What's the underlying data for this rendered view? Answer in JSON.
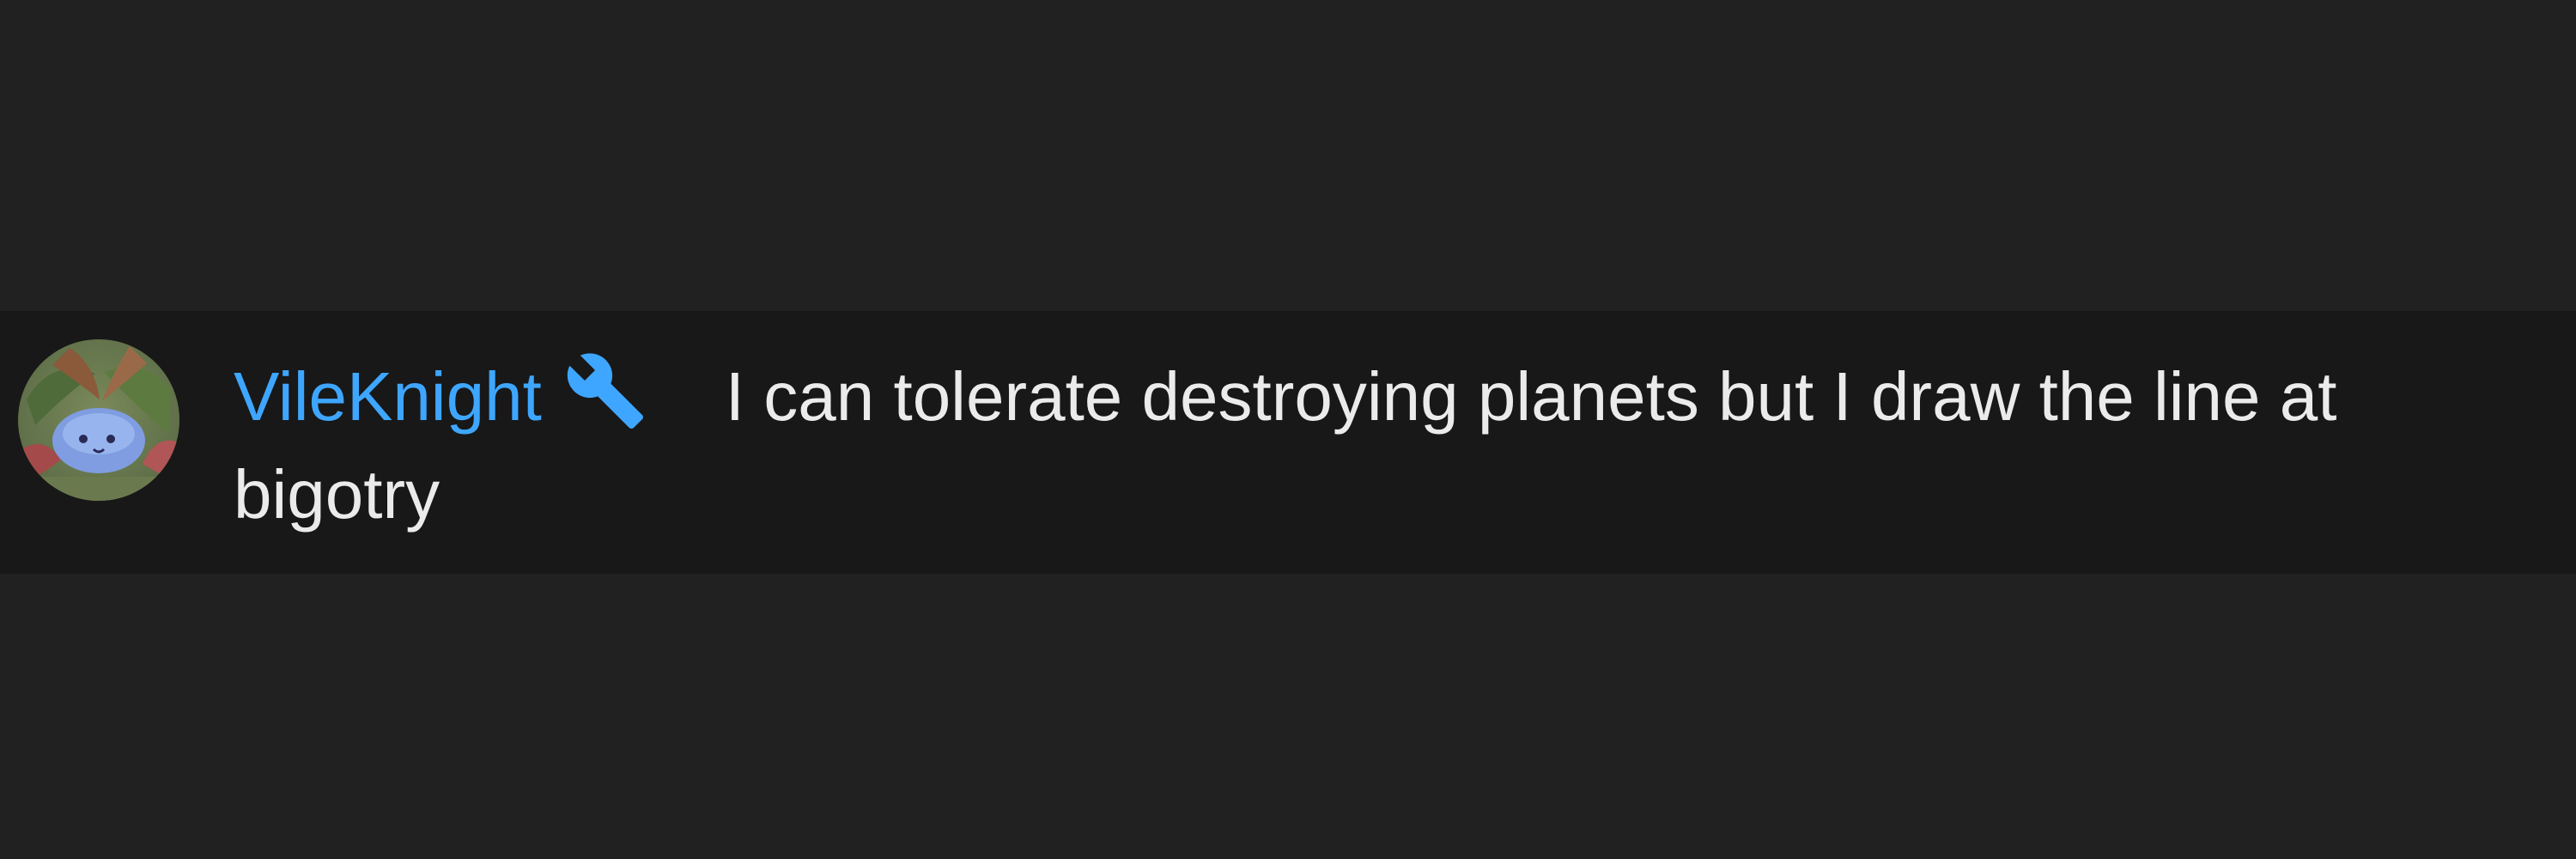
{
  "chat_message": {
    "author_name": "VileKnight",
    "badge_icon": "wrench-icon",
    "badge_color": "#3ea6ff",
    "author_color": "#3ea6ff",
    "message_text": "I can tolerate destroying planets but I draw the line at bigotry"
  },
  "colors": {
    "background": "#212121",
    "row_background": "#181818",
    "text": "#ebebeb"
  }
}
